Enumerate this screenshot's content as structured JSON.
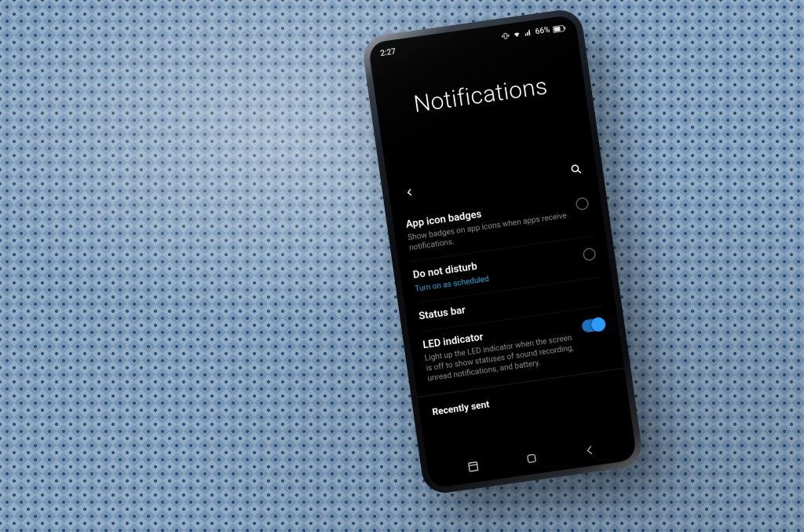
{
  "status": {
    "time": "2:27",
    "battery_pct": "66%"
  },
  "header": {
    "title": "Notifications"
  },
  "rows": {
    "badges": {
      "title": "App icon badges",
      "sub": "Show badges on app icons when apps receive notifications."
    },
    "dnd": {
      "title": "Do not disturb",
      "sub": "Turn on as scheduled"
    },
    "statusbar": {
      "title": "Status bar"
    },
    "led": {
      "title": "LED indicator",
      "sub": "Light up the LED indicator when the screen is off to show statuses of sound recording, unread notifications, and battery."
    },
    "recent": {
      "title": "Recently sent"
    }
  },
  "colors": {
    "accent": "#2aa9e0",
    "toggle_on": "#2b9bff"
  }
}
